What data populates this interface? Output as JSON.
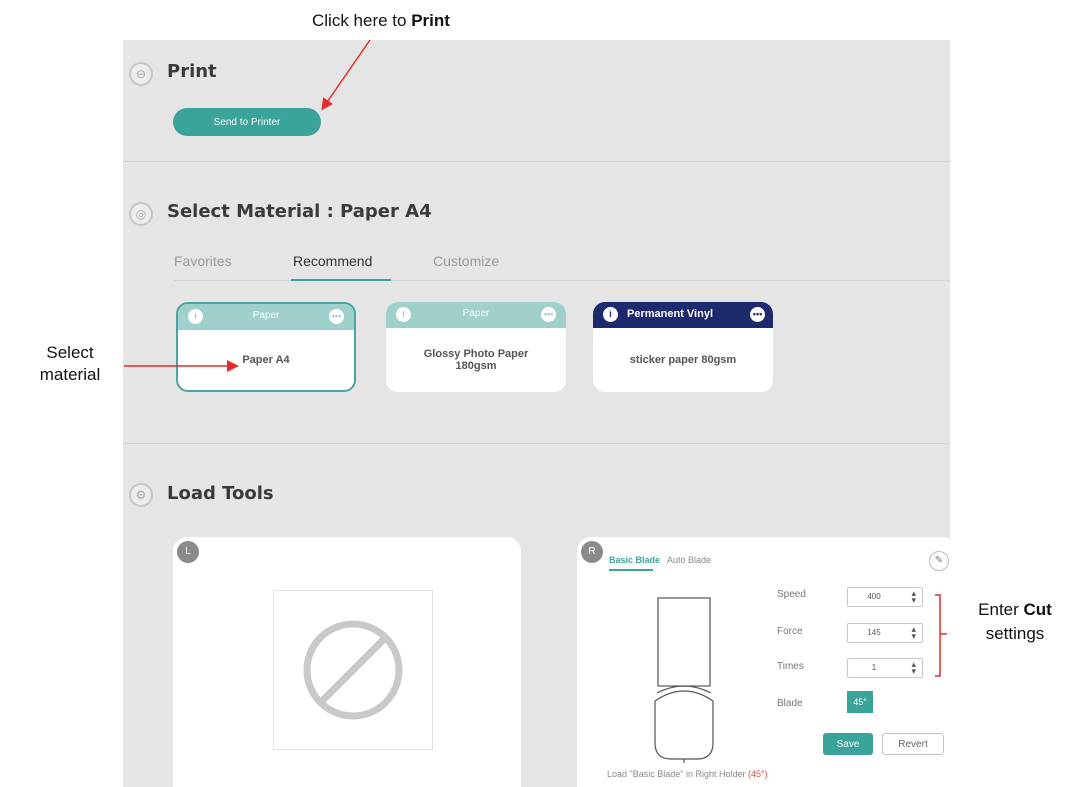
{
  "annotations": {
    "print_prefix": "Click here to ",
    "print_bold": "Print",
    "select_line1": "Select",
    "select_line2": "material",
    "cut_prefix": "Enter ",
    "cut_bold": "Cut",
    "cut_line2": "settings"
  },
  "print_section": {
    "title": "Print",
    "send_button": "Send to Printer"
  },
  "material_section": {
    "title": "Select Material : Paper A4",
    "tabs": [
      "Favorites",
      "Recommend",
      "Customize"
    ],
    "active_tab": "Recommend",
    "cards": [
      {
        "category": "Paper",
        "name": "Paper A4",
        "selected": true
      },
      {
        "category": "Paper",
        "name": "Glossy Photo Paper 180gsm",
        "selected": false
      },
      {
        "category": "Permanent Vinyl",
        "name": "sticker paper 80gsm",
        "selected": false
      }
    ]
  },
  "tools_section": {
    "title": "Load Tools",
    "left_holder": "L",
    "right_holder": "R",
    "blade_tabs": [
      "Basic Blade",
      "Auto Blade"
    ],
    "active_blade_tab": "Basic Blade",
    "settings": {
      "speed_label": "Speed",
      "speed_value": "400",
      "force_label": "Force",
      "force_value": "145",
      "times_label": "Times",
      "times_value": "1",
      "blade_label": "Blade",
      "blade_value": "45°"
    },
    "save_button": "Save",
    "revert_button": "Revert",
    "load_msg_prefix": "Load \"Basic Blade\" in Right Holder ",
    "load_msg_angle": "(45°)"
  },
  "colors": {
    "accent": "#3aa39a",
    "annotation": "#e52b2b",
    "vinyl_header": "#1e2a6e"
  }
}
